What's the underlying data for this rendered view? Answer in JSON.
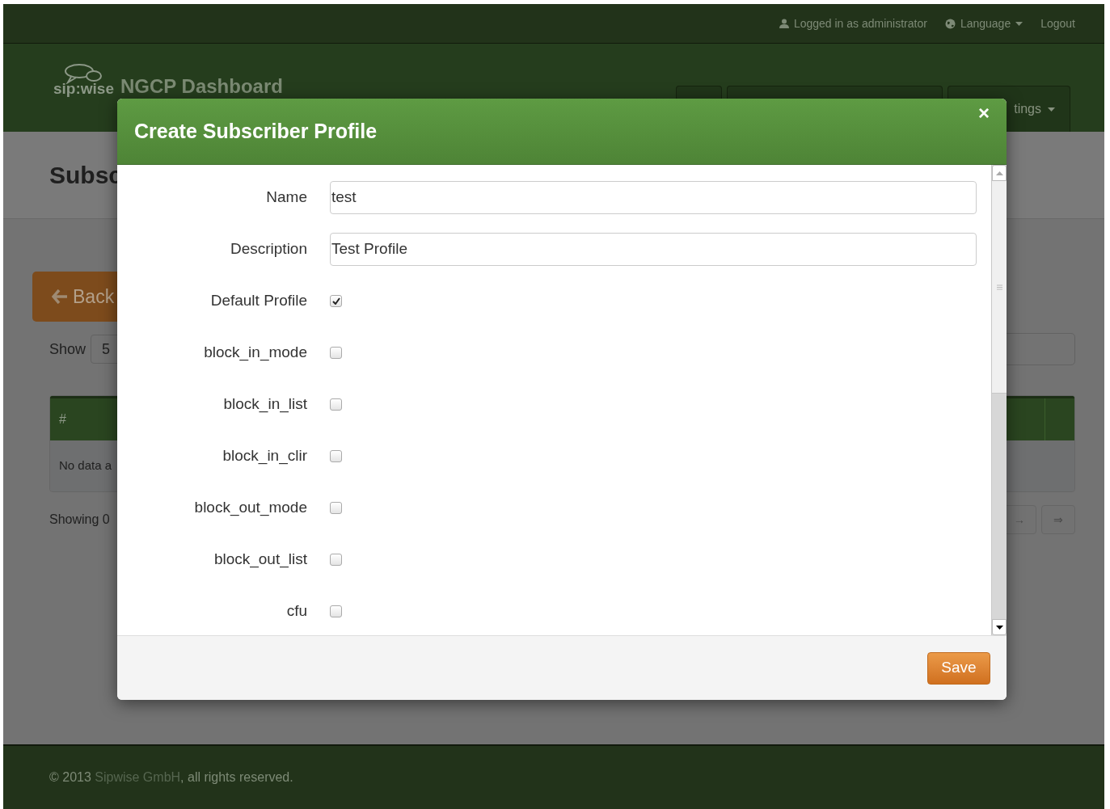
{
  "top_bar": {
    "user": "Logged in as administrator",
    "language": "Language",
    "logout": "Logout"
  },
  "header": {
    "logo_text": "sip:wise",
    "title": "NGCP Dashboard",
    "nav_item": "tings"
  },
  "page": {
    "heading": "Subsc",
    "back_button": "Back",
    "show_label": "Show",
    "show_value": "5",
    "table": {
      "header": "#",
      "empty_text": "No data a"
    },
    "showing_text": "Showing 0",
    "pager": [
      "→",
      "⇒"
    ]
  },
  "modal": {
    "title": "Create Subscriber Profile",
    "close": "×",
    "fields": [
      {
        "kind": "text",
        "label": "Name",
        "value": "test"
      },
      {
        "kind": "text",
        "label": "Description",
        "value": "Test Profile"
      },
      {
        "kind": "checkbox",
        "label": "Default Profile",
        "checked": true
      },
      {
        "kind": "checkbox",
        "label": "block_in_mode",
        "checked": false
      },
      {
        "kind": "checkbox",
        "label": "block_in_list",
        "checked": false
      },
      {
        "kind": "checkbox",
        "label": "block_in_clir",
        "checked": false
      },
      {
        "kind": "checkbox",
        "label": "block_out_mode",
        "checked": false
      },
      {
        "kind": "checkbox",
        "label": "block_out_list",
        "checked": false
      },
      {
        "kind": "checkbox",
        "label": "cfu",
        "checked": false
      }
    ],
    "save_button": "Save"
  },
  "footer": {
    "copyright": "© 2013",
    "company": "Sipwise GmbH",
    "rights": ", all rights reserved."
  }
}
